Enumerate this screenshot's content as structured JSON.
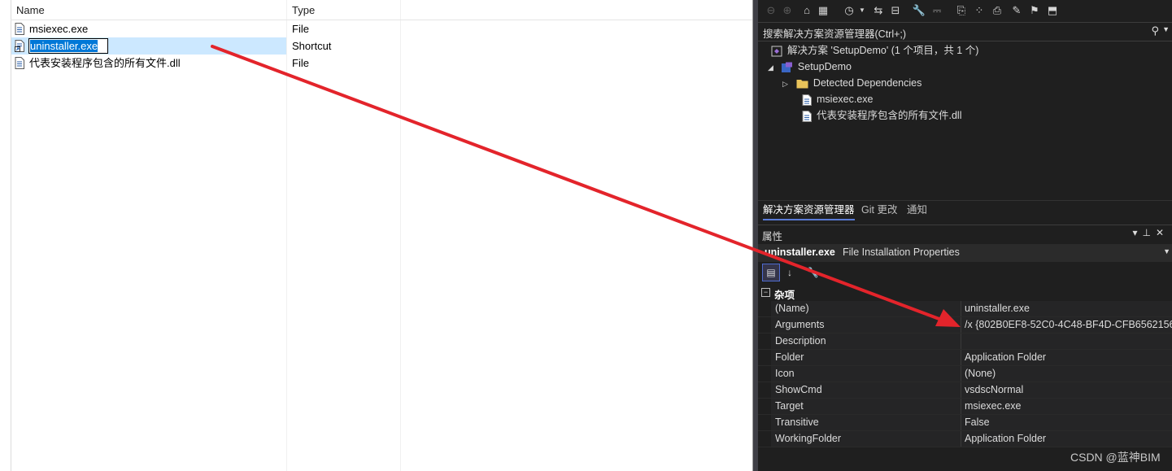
{
  "file_list": {
    "columns": {
      "name": "Name",
      "type": "Type"
    },
    "rows": [
      {
        "name": "msiexec.exe",
        "type": "File",
        "icon": "file-icon"
      },
      {
        "name": "uninstaller.exe",
        "type": "Shortcut",
        "icon": "shortcut-icon",
        "selected": true,
        "editing": true
      },
      {
        "name": "代表安装程序包含的所有文件.dll",
        "type": "File",
        "icon": "file-icon"
      }
    ]
  },
  "solution_explorer": {
    "search_placeholder": "搜索解决方案资源管理器(Ctrl+;)",
    "solution_label": "解决方案 'SetupDemo' (1 个项目，共 1 个)",
    "project": "SetupDemo",
    "items": [
      {
        "label": "Detected Dependencies",
        "icon": "folder-icon"
      },
      {
        "label": "msiexec.exe",
        "icon": "file-icon"
      },
      {
        "label": "代表安装程序包含的所有文件.dll",
        "icon": "file-icon"
      }
    ],
    "tabs": [
      "解决方案资源管理器",
      "Git 更改",
      "通知"
    ]
  },
  "properties": {
    "title": "属性",
    "object_name": "uninstaller.exe",
    "object_kind": "File Installation Properties",
    "category": "杂项",
    "rows": [
      {
        "key": "(Name)",
        "value": "uninstaller.exe"
      },
      {
        "key": "Arguments",
        "value": "/x {802B0EF8-52C0-4C48-BF4D-CFB6562156"
      },
      {
        "key": "Description",
        "value": ""
      },
      {
        "key": "Folder",
        "value": "Application Folder"
      },
      {
        "key": "Icon",
        "value": "(None)"
      },
      {
        "key": "ShowCmd",
        "value": "vsdscNormal"
      },
      {
        "key": "Target",
        "value": "msiexec.exe"
      },
      {
        "key": "Transitive",
        "value": "False"
      },
      {
        "key": "WorkingFolder",
        "value": "Application Folder"
      }
    ]
  },
  "watermark": "CSDN @蓝神BIM",
  "colors": {
    "annotation_arrow": "#e3242b",
    "selection": "#cce8ff",
    "vs_background": "#1f1f1f"
  }
}
